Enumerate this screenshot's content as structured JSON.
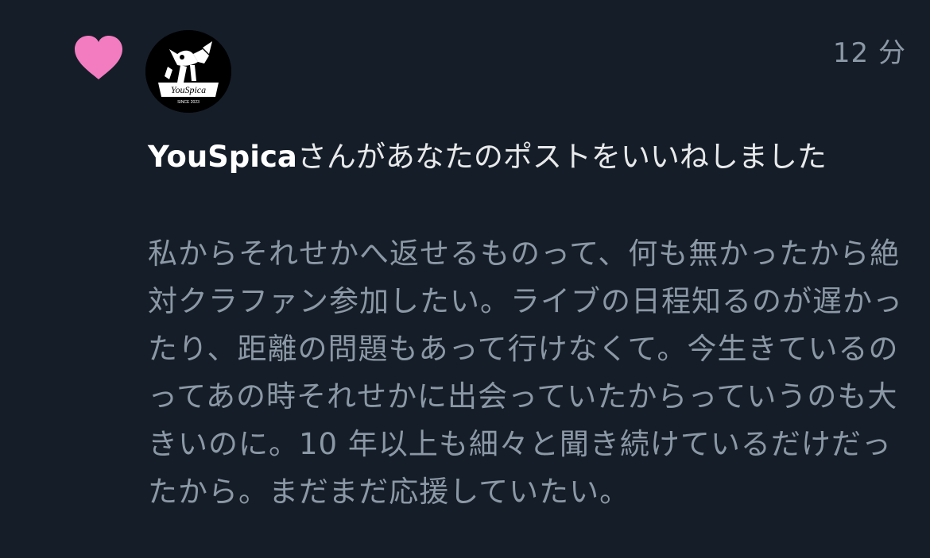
{
  "notification": {
    "type_icon": "heart-icon",
    "timestamp": "12 分",
    "avatar": {
      "logo_text": "YouSpica",
      "logo_sub": "SINCE 2023"
    },
    "user_name": "YouSpica",
    "action_text": "さんがあなたのポストをいいねしました",
    "post_text": "私からそれせかへ返せるものって、何も無かったから絶対クラファン参加したい。ライブの日程知るのが遅かったり、距離の問題もあって行けなくて。今生きているのってあの時それせかに出会っていたからっていうのも大きいのに。10 年以上も細々と聞き続けているだけだったから。まだまだ応援していたい。"
  },
  "colors": {
    "background": "#151d28",
    "heart": "#f37cc1",
    "muted_text": "#8b98a5",
    "primary_text": "#e7e9ea"
  }
}
